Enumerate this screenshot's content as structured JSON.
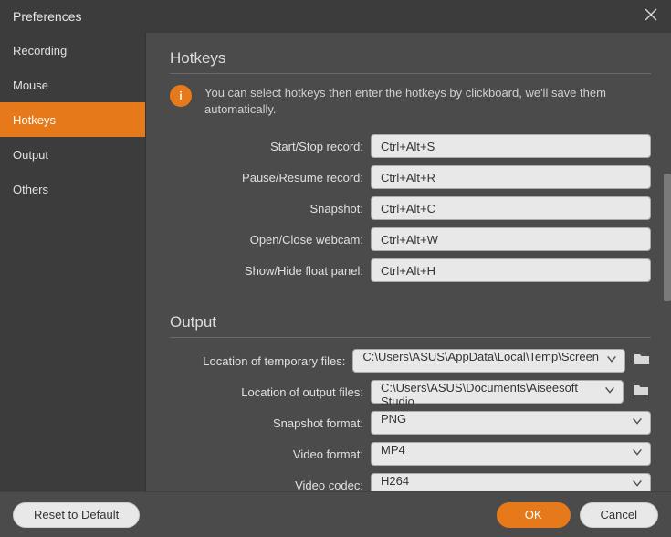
{
  "window": {
    "title": "Preferences"
  },
  "sidebar": {
    "items": [
      {
        "label": "Recording",
        "active": false
      },
      {
        "label": "Mouse",
        "active": false
      },
      {
        "label": "Hotkeys",
        "active": true
      },
      {
        "label": "Output",
        "active": false
      },
      {
        "label": "Others",
        "active": false
      }
    ]
  },
  "sections": {
    "hotkeys": {
      "title": "Hotkeys",
      "info": "You can select hotkeys then enter the hotkeys by clickboard, we'll save them automatically.",
      "fields": [
        {
          "label": "Start/Stop record:",
          "value": "Ctrl+Alt+S"
        },
        {
          "label": "Pause/Resume record:",
          "value": "Ctrl+Alt+R"
        },
        {
          "label": "Snapshot:",
          "value": "Ctrl+Alt+C"
        },
        {
          "label": "Open/Close webcam:",
          "value": "Ctrl+Alt+W"
        },
        {
          "label": "Show/Hide float panel:",
          "value": "Ctrl+Alt+H"
        }
      ]
    },
    "output": {
      "title": "Output",
      "fields": [
        {
          "label": "Location of temporary files:",
          "value": "C:\\Users\\ASUS\\AppData\\Local\\Temp\\Screen",
          "type": "path"
        },
        {
          "label": "Location of output files:",
          "value": "C:\\Users\\ASUS\\Documents\\Aiseesoft Studio",
          "type": "path"
        },
        {
          "label": "Snapshot format:",
          "value": "PNG",
          "type": "select"
        },
        {
          "label": "Video format:",
          "value": "MP4",
          "type": "select"
        },
        {
          "label": "Video codec:",
          "value": "H264",
          "type": "select"
        }
      ]
    }
  },
  "footer": {
    "reset": "Reset to Default",
    "ok": "OK",
    "cancel": "Cancel"
  }
}
